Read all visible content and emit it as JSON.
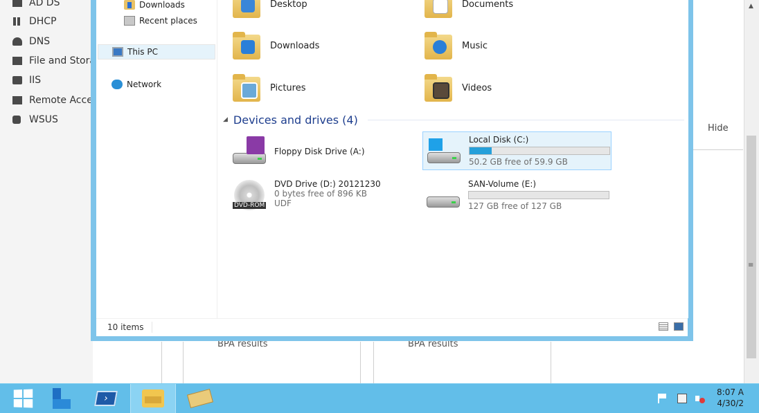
{
  "server_manager": {
    "sidebar_items": [
      {
        "label": "AD DS",
        "icon": "ad-ds-icon"
      },
      {
        "label": "DHCP",
        "icon": "dhcp-icon"
      },
      {
        "label": "DNS",
        "icon": "dns-icon"
      },
      {
        "label": "File and Stora",
        "icon": "file-storage-icon"
      },
      {
        "label": "IIS",
        "icon": "iis-icon"
      },
      {
        "label": "Remote Acce",
        "icon": "remote-access-icon"
      },
      {
        "label": "WSUS",
        "icon": "wsus-icon"
      }
    ],
    "hide_label": "Hide",
    "bpa_labels": [
      "BPA results",
      "BPA results"
    ]
  },
  "explorer": {
    "nav": {
      "items": [
        {
          "label": "Downloads",
          "icon": "downloads-folder-icon"
        },
        {
          "label": "Recent places",
          "icon": "recent-places-icon"
        },
        {
          "label": "This PC",
          "icon": "this-pc-icon",
          "selected": true
        },
        {
          "label": "Network",
          "icon": "network-icon"
        }
      ]
    },
    "folders": [
      {
        "label": "Desktop",
        "icon": "desktop-folder-icon"
      },
      {
        "label": "Documents",
        "icon": "documents-folder-icon"
      },
      {
        "label": "Downloads",
        "icon": "downloads-folder-icon"
      },
      {
        "label": "Music",
        "icon": "music-folder-icon"
      },
      {
        "label": "Pictures",
        "icon": "pictures-folder-icon"
      },
      {
        "label": "Videos",
        "icon": "videos-folder-icon"
      }
    ],
    "devices_header": "Devices and drives (4)",
    "drives": {
      "floppy": {
        "name": "Floppy Disk Drive (A:)",
        "icon": "floppy-drive-icon"
      },
      "c": {
        "name": "Local Disk (C:)",
        "free": "50.2 GB free of 59.9 GB",
        "used_fraction": 0.16,
        "icon": "local-disk-icon",
        "selected": true
      },
      "dvd": {
        "name": "DVD Drive (D:) 20121230",
        "free": "0 bytes free of 896 KB",
        "fs": "UDF",
        "tag": "DVD-ROM",
        "icon": "dvd-drive-icon"
      },
      "e": {
        "name": "SAN-Volume (E:)",
        "free": "127 GB free of 127 GB",
        "used_fraction": 0.0,
        "icon": "san-volume-icon"
      }
    },
    "status": {
      "item_count": "10 items"
    }
  },
  "taskbar": {
    "buttons": [
      {
        "name": "start",
        "icon": "windows-start-icon"
      },
      {
        "name": "server-manager",
        "icon": "server-manager-icon"
      },
      {
        "name": "powershell",
        "icon": "powershell-icon"
      },
      {
        "name": "file-explorer",
        "icon": "file-explorer-icon",
        "active": true
      },
      {
        "name": "cabinet",
        "icon": "cabinet-icon"
      }
    ],
    "clock_time": "8:07 A",
    "clock_date": "4/30/2"
  },
  "colors": {
    "window_border": "#7ec4ea",
    "taskbar": "#62bee9",
    "drive_bar_fill": "#26a0da",
    "group_header_text": "#1e3e8e"
  }
}
